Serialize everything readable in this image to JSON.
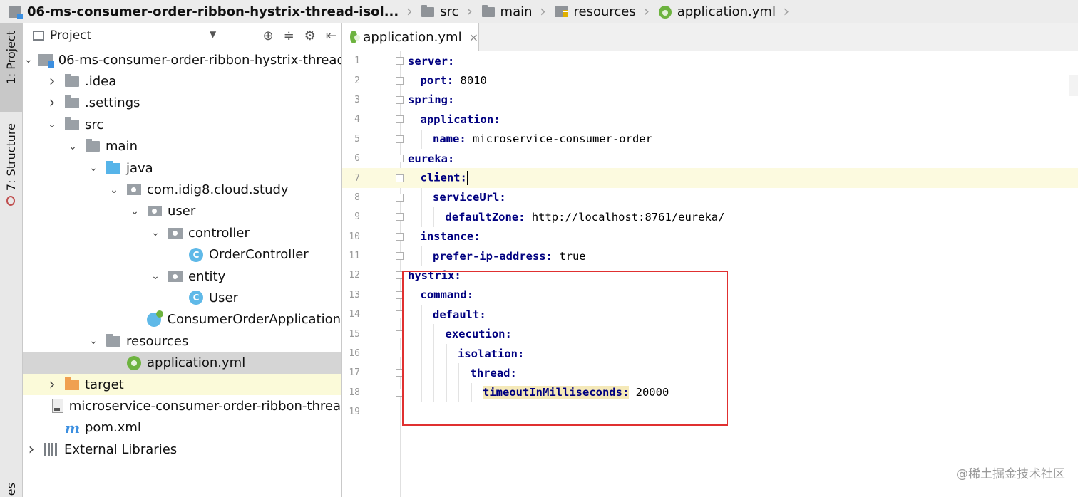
{
  "breadcrumb": {
    "items": [
      {
        "label": "06-ms-consumer-order-ribbon-hystrix-thread-isol...",
        "icon": "module-icon"
      },
      {
        "label": "src",
        "icon": "folder-icon"
      },
      {
        "label": "main",
        "icon": "folder-icon"
      },
      {
        "label": "resources",
        "icon": "resources-folder-icon"
      },
      {
        "label": "application.yml",
        "icon": "spring-leaf-icon"
      }
    ]
  },
  "toolstrip": {
    "project_label": "1: Project",
    "structure_label": "7: Structure",
    "bottom_label": "es"
  },
  "project_panel": {
    "title": "Project",
    "tree": [
      {
        "label": "06-ms-consumer-order-ribbon-hystrix-thread-",
        "depth": 0,
        "arrow": "down",
        "icon": "module"
      },
      {
        "label": ".idea",
        "depth": 1,
        "arrow": "right",
        "icon": "folder"
      },
      {
        "label": ".settings",
        "depth": 1,
        "arrow": "right",
        "icon": "folder"
      },
      {
        "label": "src",
        "depth": 1,
        "arrow": "down",
        "icon": "folder"
      },
      {
        "label": "main",
        "depth": 2,
        "arrow": "down",
        "icon": "folder"
      },
      {
        "label": "java",
        "depth": 3,
        "arrow": "down",
        "icon": "source-folder"
      },
      {
        "label": "com.idig8.cloud.study",
        "depth": 4,
        "arrow": "down",
        "icon": "package"
      },
      {
        "label": "user",
        "depth": 5,
        "arrow": "down",
        "icon": "package"
      },
      {
        "label": "controller",
        "depth": 6,
        "arrow": "down",
        "icon": "package"
      },
      {
        "label": "OrderController",
        "depth": 7,
        "arrow": "",
        "icon": "class"
      },
      {
        "label": "entity",
        "depth": 6,
        "arrow": "down",
        "icon": "package"
      },
      {
        "label": "User",
        "depth": 7,
        "arrow": "",
        "icon": "class"
      },
      {
        "label": "ConsumerOrderApplication",
        "depth": 5,
        "arrow": "",
        "icon": "spring-app"
      },
      {
        "label": "resources",
        "depth": 3,
        "arrow": "down",
        "icon": "resources"
      },
      {
        "label": "application.yml",
        "depth": 4,
        "arrow": "",
        "icon": "spring-leaf",
        "selected": true
      },
      {
        "label": "target",
        "depth": 1,
        "arrow": "right",
        "icon": "excluded-folder",
        "highlight": true
      },
      {
        "label": "microservice-consumer-order-ribbon-threa",
        "depth": 1,
        "arrow": "",
        "icon": "file"
      },
      {
        "label": "pom.xml",
        "depth": 1,
        "arrow": "",
        "icon": "maven"
      },
      {
        "label": "External Libraries",
        "depth": 0,
        "arrow": "right",
        "icon": "library"
      }
    ]
  },
  "editor": {
    "tab_label": "application.yml",
    "tab_close": "×",
    "lines": [
      {
        "n": "1",
        "indent": 0,
        "key": "server:",
        "value": ""
      },
      {
        "n": "2",
        "indent": 1,
        "key": "port:",
        "value": " 8010"
      },
      {
        "n": "3",
        "indent": 0,
        "key": "spring:",
        "value": ""
      },
      {
        "n": "4",
        "indent": 1,
        "key": "application:",
        "value": ""
      },
      {
        "n": "5",
        "indent": 2,
        "key": "name:",
        "value": " microservice-consumer-order"
      },
      {
        "n": "6",
        "indent": 0,
        "key": "eureka:",
        "value": ""
      },
      {
        "n": "7",
        "indent": 1,
        "key": "client:",
        "value": "",
        "current": true
      },
      {
        "n": "8",
        "indent": 2,
        "key": "serviceUrl:",
        "value": ""
      },
      {
        "n": "9",
        "indent": 3,
        "key": "defaultZone:",
        "value": " http://localhost:8761/eureka/"
      },
      {
        "n": "10",
        "indent": 1,
        "key": "instance:",
        "value": ""
      },
      {
        "n": "11",
        "indent": 2,
        "key": "prefer-ip-address:",
        "value": " true"
      },
      {
        "n": "12",
        "indent": 0,
        "key": "hystrix:",
        "value": ""
      },
      {
        "n": "13",
        "indent": 1,
        "key": "command:",
        "value": ""
      },
      {
        "n": "14",
        "indent": 2,
        "key": "default:",
        "value": ""
      },
      {
        "n": "15",
        "indent": 3,
        "key": "execution:",
        "value": ""
      },
      {
        "n": "16",
        "indent": 4,
        "key": "isolation:",
        "value": ""
      },
      {
        "n": "17",
        "indent": 5,
        "key": "thread:",
        "value": ""
      },
      {
        "n": "18",
        "indent": 6,
        "key": "timeoutInMilliseconds:",
        "value": " 20000",
        "key_highlight": true
      },
      {
        "n": "19",
        "indent": 0,
        "key": "",
        "value": ""
      }
    ]
  },
  "watermark": "@稀土掘金技术社区",
  "colors": {
    "key": "#000080",
    "highlight_box": "#e03030",
    "current_line": "#fcfadf",
    "selection": "#d5d5d5"
  }
}
